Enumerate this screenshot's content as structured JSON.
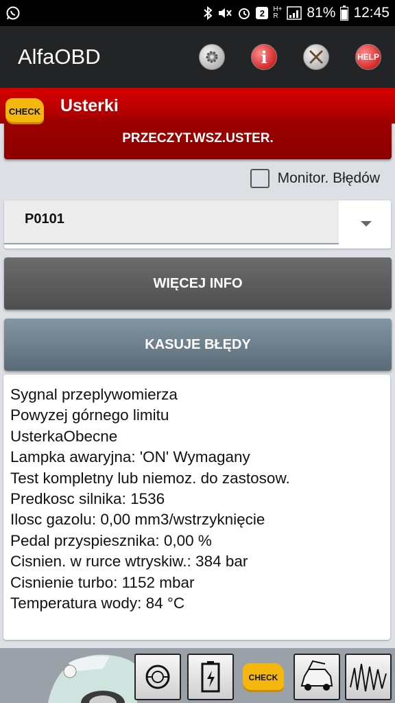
{
  "status_bar": {
    "battery": "81%",
    "time": "12:45",
    "sim_badge": "2",
    "network_top": "H+",
    "network_bottom": "R"
  },
  "app_bar": {
    "title": "AlfaOBD",
    "help_label": "HELP",
    "info_label": "i"
  },
  "section": {
    "title": "Usterki",
    "check_label": "CHECK"
  },
  "buttons": {
    "read_all": "PRZECZYT.WSZ.USTER.",
    "more_info": "WIĘCEJ INFO",
    "clear_errors": "KASUJE BŁĘDY"
  },
  "monitor": {
    "label": "Monitor. Błędów",
    "checked": false
  },
  "dtc_select": {
    "selected": "P0101"
  },
  "info_lines": [
    "Sygnal przeplywomierza",
    "Powyzej górnego limitu",
    "UsterkaObecne",
    "Lampka awaryjna: 'ON' Wymagany",
    "Test kompletny lub niemoz. do zastosow.",
    "Predkosc silnika: 1536",
    "Ilosc gazolu: 0,00 mm3/wstrzyknięcie",
    "Pedal przyspiesznika: 0,00 %",
    "Cisnien. w rurce wtryskiw.: 384 bar",
    "Cisnienie turbo: 1152 mbar",
    "Temperatura wody: 84 °C"
  ],
  "bottom_bar": {
    "check_label": "CHECK",
    "icons": [
      "car-image",
      "gauge-icon",
      "battery-icon",
      "check-engine-icon",
      "car-hood-icon",
      "waveform-icon"
    ]
  },
  "colors": {
    "header_red": "#c00000",
    "button_red": "#8b0000",
    "check_yellow": "#f3b70e"
  }
}
